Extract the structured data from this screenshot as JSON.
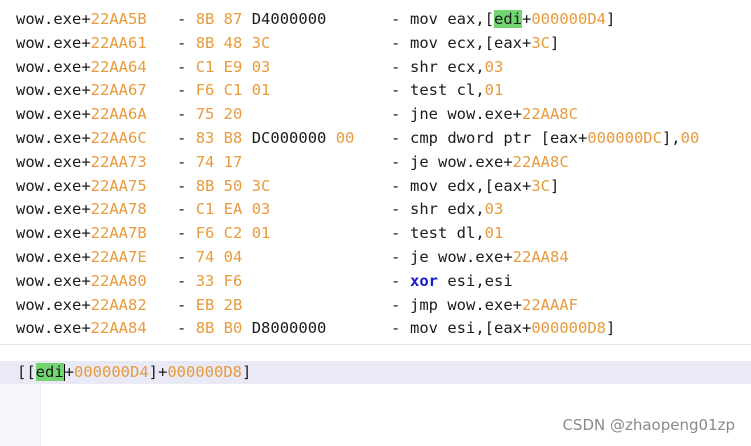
{
  "rows": [
    {
      "addr_prefix": "wow.exe+",
      "addr_offset": "22AA5B",
      "bytes_op": "8B 87",
      "bytes_imm": "D4000000",
      "asm": [
        {
          "t": "mov eax,",
          "c": "dark"
        },
        {
          "t": "[",
          "c": "dark"
        },
        {
          "t": "edi",
          "c": "dark",
          "hl": true
        },
        {
          "t": "+",
          "c": "dark"
        },
        {
          "t": "000000D4",
          "c": "num"
        },
        {
          "t": "]",
          "c": "dark"
        }
      ]
    },
    {
      "addr_prefix": "wow.exe+",
      "addr_offset": "22AA61",
      "bytes_op": "8B 48 3C",
      "bytes_imm": "",
      "asm": [
        {
          "t": "mov ecx,[eax+",
          "c": "dark"
        },
        {
          "t": "3C",
          "c": "num"
        },
        {
          "t": "]",
          "c": "dark"
        }
      ]
    },
    {
      "addr_prefix": "wow.exe+",
      "addr_offset": "22AA64",
      "bytes_op": "C1 E9",
      "bytes_imm": "03",
      "imm_num": true,
      "asm": [
        {
          "t": "shr ecx,",
          "c": "dark"
        },
        {
          "t": "03",
          "c": "num"
        }
      ]
    },
    {
      "addr_prefix": "wow.exe+",
      "addr_offset": "22AA67",
      "bytes_op": "F6 C1",
      "bytes_imm": "01",
      "imm_num": true,
      "asm": [
        {
          "t": "test cl,",
          "c": "dark"
        },
        {
          "t": "01",
          "c": "num"
        }
      ]
    },
    {
      "addr_prefix": "wow.exe+",
      "addr_offset": "22AA6A",
      "bytes_op": "75 20",
      "bytes_imm": "",
      "asm": [
        {
          "t": "jne wow.exe+",
          "c": "dark"
        },
        {
          "t": "22AA8C",
          "c": "num"
        }
      ]
    },
    {
      "addr_prefix": "wow.exe+",
      "addr_offset": "22AA6C",
      "bytes_op": "83 B8",
      "bytes_imm": "DC000000",
      "imm_tail": "00",
      "asm": [
        {
          "t": "cmp dword ptr [eax+",
          "c": "dark"
        },
        {
          "t": "000000DC",
          "c": "num"
        },
        {
          "t": "],",
          "c": "dark"
        },
        {
          "t": "00",
          "c": "num"
        }
      ]
    },
    {
      "addr_prefix": "wow.exe+",
      "addr_offset": "22AA73",
      "bytes_op": "74 17",
      "bytes_imm": "",
      "asm": [
        {
          "t": "je wow.exe+",
          "c": "dark"
        },
        {
          "t": "22AA8C",
          "c": "num"
        }
      ]
    },
    {
      "addr_prefix": "wow.exe+",
      "addr_offset": "22AA75",
      "bytes_op": "8B 50 3C",
      "bytes_imm": "",
      "asm": [
        {
          "t": "mov edx,[eax+",
          "c": "dark"
        },
        {
          "t": "3C",
          "c": "num"
        },
        {
          "t": "]",
          "c": "dark"
        }
      ]
    },
    {
      "addr_prefix": "wow.exe+",
      "addr_offset": "22AA78",
      "bytes_op": "C1 EA",
      "bytes_imm": "03",
      "imm_num": true,
      "asm": [
        {
          "t": "shr edx,",
          "c": "dark"
        },
        {
          "t": "03",
          "c": "num"
        }
      ]
    },
    {
      "addr_prefix": "wow.exe+",
      "addr_offset": "22AA7B",
      "bytes_op": "F6 C2",
      "bytes_imm": "01",
      "imm_num": true,
      "asm": [
        {
          "t": "test dl,",
          "c": "dark"
        },
        {
          "t": "01",
          "c": "num"
        }
      ]
    },
    {
      "addr_prefix": "wow.exe+",
      "addr_offset": "22AA7E",
      "bytes_op": "74 04",
      "bytes_imm": "",
      "asm": [
        {
          "t": "je wow.exe+",
          "c": "dark"
        },
        {
          "t": "22AA84",
          "c": "num"
        }
      ]
    },
    {
      "addr_prefix": "wow.exe+",
      "addr_offset": "22AA80",
      "bytes_op": "33 F6",
      "bytes_imm": "",
      "asm": [
        {
          "t": "xor",
          "c": "kw"
        },
        {
          "t": " esi,esi",
          "c": "dark"
        }
      ]
    },
    {
      "addr_prefix": "wow.exe+",
      "addr_offset": "22AA82",
      "bytes_op": "EB 2B",
      "bytes_imm": "",
      "asm": [
        {
          "t": "jmp wow.exe+",
          "c": "dark"
        },
        {
          "t": "22AAAF",
          "c": "num"
        }
      ]
    },
    {
      "addr_prefix": "wow.exe+",
      "addr_offset": "22AA84",
      "bytes_op": "8B B0",
      "bytes_imm": "D8000000",
      "asm": [
        {
          "t": "mov esi,[eax+",
          "c": "dark"
        },
        {
          "t": "000000D8",
          "c": "num"
        },
        {
          "t": "]",
          "c": "dark"
        }
      ]
    }
  ],
  "dash": "-",
  "expression": {
    "open": "[[",
    "reg": "edi",
    "plus1": "+",
    "off1": "000000D4",
    "mid": "]+",
    "off2": "000000D8",
    "close": "]"
  },
  "watermark": "CSDN @zhaopeng01zp",
  "colors": {
    "number": "#e89a3c",
    "keyword": "#1a1acc",
    "highlight": "#72d572",
    "text": "#1b1b1b"
  }
}
